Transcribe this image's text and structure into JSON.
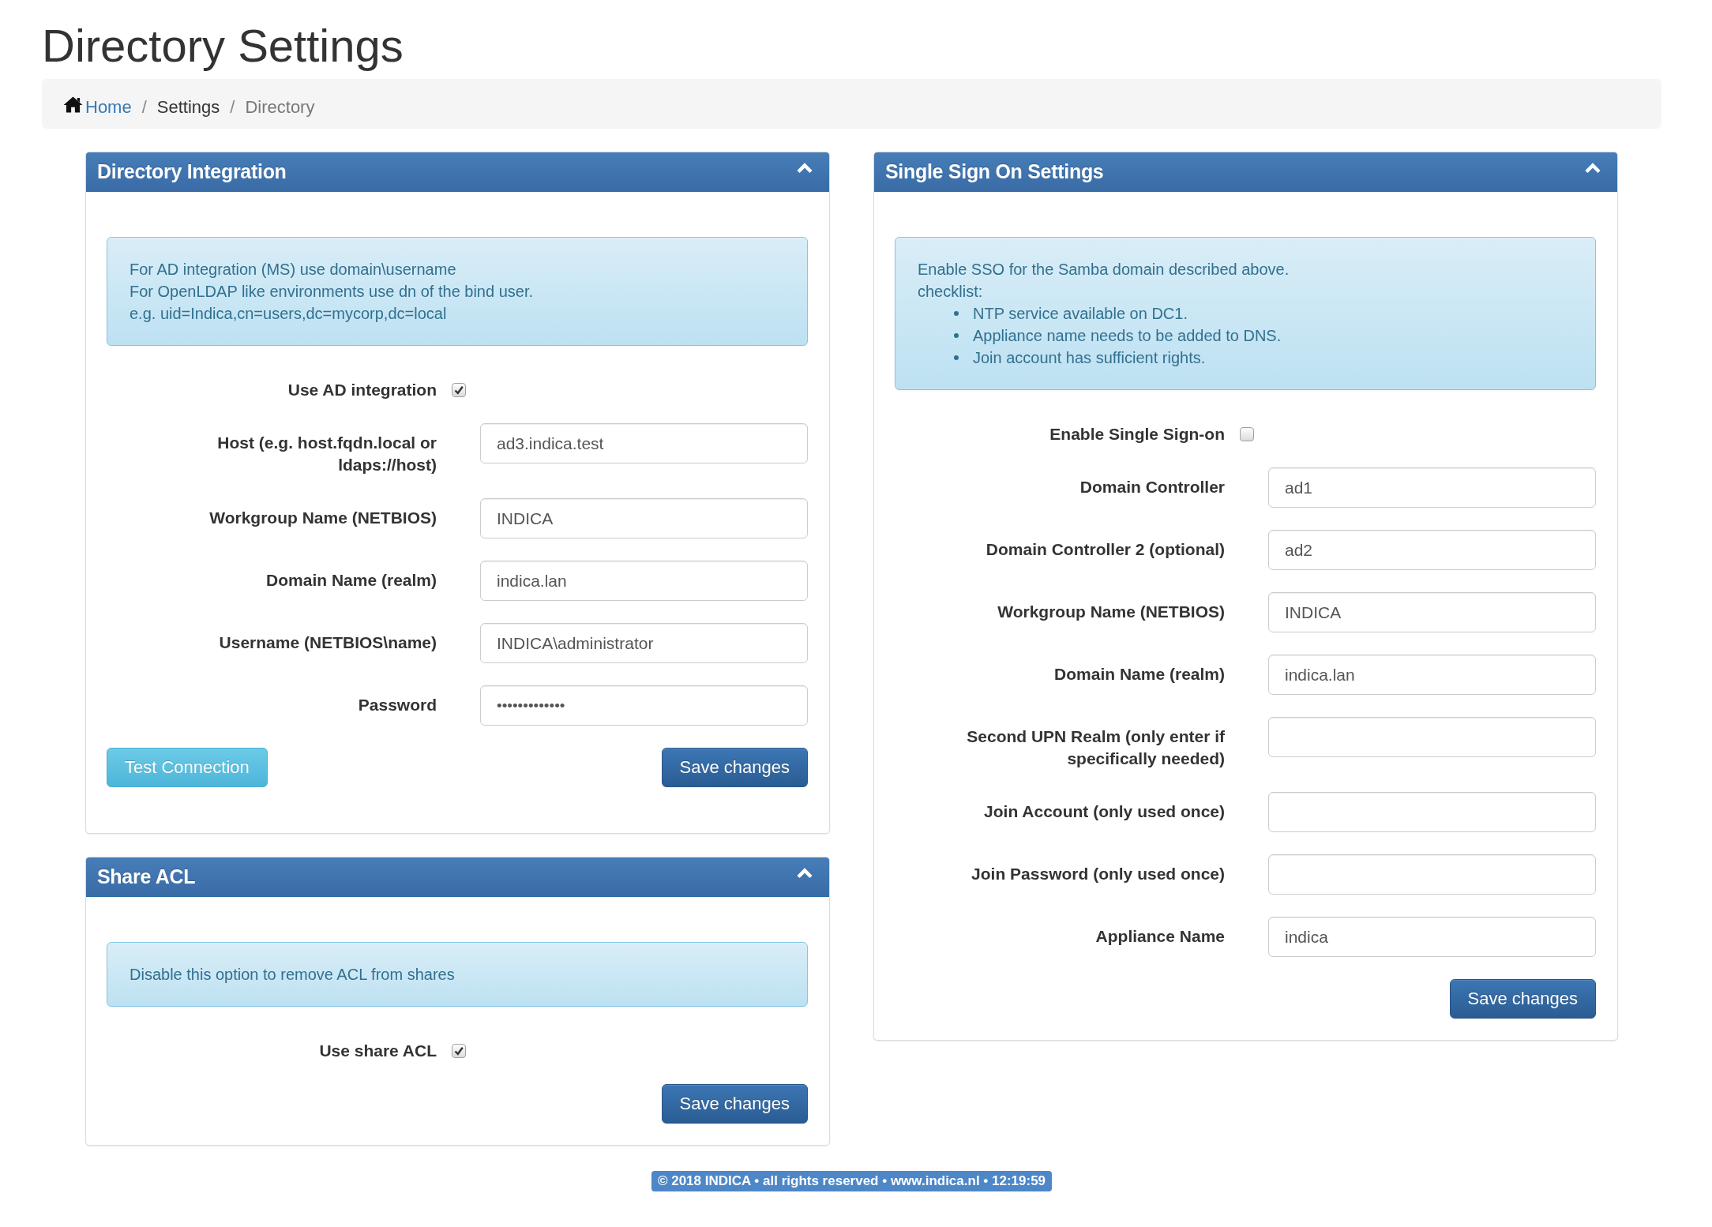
{
  "page": {
    "title": "Directory Settings"
  },
  "breadcrumb": [
    {
      "label": "Home",
      "kind": "link"
    },
    {
      "separator": "/",
      "label": "Settings",
      "kind": "text"
    },
    {
      "separator": "/",
      "label": "Directory",
      "kind": "active"
    }
  ],
  "columns": [
    {
      "panels": [
        {
          "title": "Directory Integration",
          "expanded": true,
          "info": {
            "lines": [
              "For AD integration (MS) use domain\\username",
              "For OpenLDAP like environments use dn of the bind user.",
              "e.g. uid=Indica,cn=users,dc=mycorp,dc=local"
            ]
          },
          "fields": [
            {
              "kind": "checkbox",
              "label": "Use AD integration",
              "checked": true
            },
            {
              "kind": "text",
              "label": "Host (e.g. host.fqdn.local or ldaps://host)",
              "value": "ad3.indica.test"
            },
            {
              "kind": "text",
              "label": "Workgroup Name (NETBIOS)",
              "value": "INDICA"
            },
            {
              "kind": "text",
              "label": "Domain Name (realm)",
              "value": "indica.lan"
            },
            {
              "kind": "text",
              "label": "Username (NETBIOS\\name)",
              "value": "INDICA\\administrator"
            },
            {
              "kind": "password",
              "label": "Password",
              "value": "•••••••••••••"
            }
          ],
          "buttons": [
            {
              "kind": "info",
              "label": "Test Connection"
            },
            {
              "kind": "primary",
              "label": "Save changes"
            }
          ]
        },
        {
          "title": "Share ACL",
          "expanded": true,
          "info": {
            "lines": [
              "Disable this option to remove ACL from shares"
            ]
          },
          "fields": [
            {
              "kind": "checkbox",
              "label": "Use share ACL",
              "checked": true
            }
          ],
          "buttons": [
            {
              "kind": "primary",
              "label": "Save changes"
            }
          ]
        }
      ]
    },
    {
      "panels": [
        {
          "title": "Single Sign On Settings",
          "expanded": true,
          "info": {
            "lines": [
              "Enable SSO for the Samba domain described above.",
              "checklist:"
            ],
            "bullets": [
              "NTP service available on DC1.",
              "Appliance name needs to be added to DNS.",
              "Join account has sufficient rights."
            ]
          },
          "fields": [
            {
              "kind": "checkbox",
              "label": "Enable Single Sign-on",
              "checked": false
            },
            {
              "kind": "text",
              "label": "Domain Controller",
              "value": "ad1"
            },
            {
              "kind": "text",
              "label": "Domain Controller 2 (optional)",
              "value": "ad2"
            },
            {
              "kind": "text",
              "label": "Workgroup Name (NETBIOS)",
              "value": "INDICA"
            },
            {
              "kind": "text",
              "label": "Domain Name (realm)",
              "value": "indica.lan"
            },
            {
              "kind": "text",
              "label": "Second UPN Realm (only enter if specifically needed)"
            },
            {
              "kind": "text",
              "label": "Join Account (only used once)"
            },
            {
              "kind": "password",
              "label": "Join Password (only used once)"
            },
            {
              "kind": "text",
              "label": "Appliance Name",
              "value": "indica"
            }
          ],
          "buttons": [
            {
              "kind": "primary",
              "label": "Save changes"
            }
          ]
        }
      ]
    }
  ],
  "footer": {
    "text": "© 2018 INDICA • all rights reserved • www.indica.nl • 12:19:59"
  }
}
